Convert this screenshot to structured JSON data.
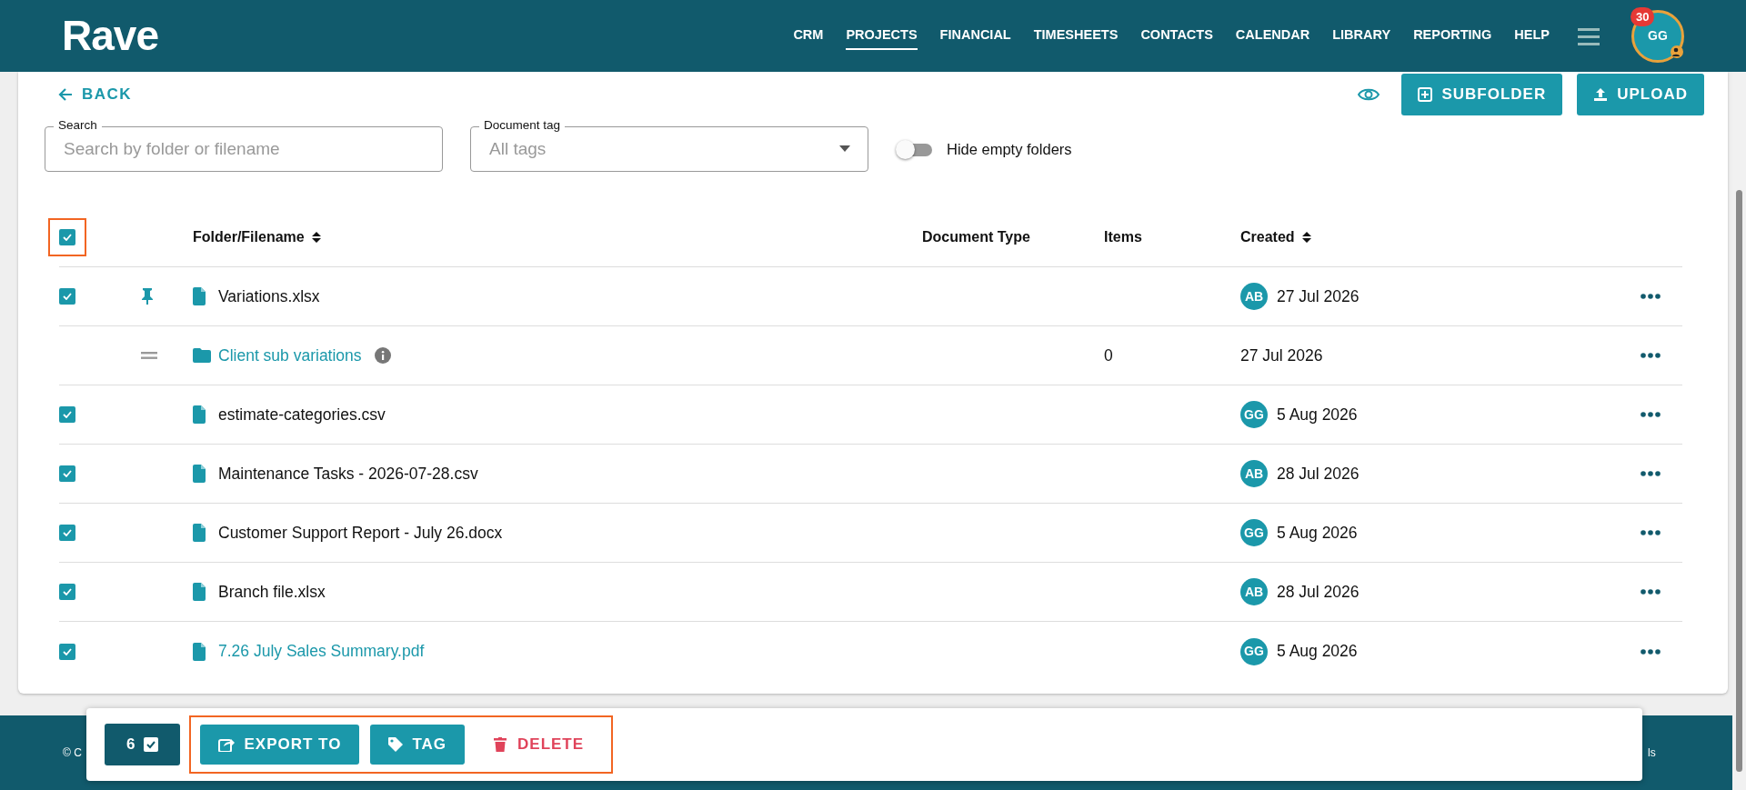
{
  "header": {
    "logo": "Rave",
    "nav": [
      {
        "label": "CRM",
        "selected": false
      },
      {
        "label": "PROJECTS",
        "selected": true
      },
      {
        "label": "FINANCIAL",
        "selected": false
      },
      {
        "label": "TIMESHEETS",
        "selected": false
      },
      {
        "label": "CONTACTS",
        "selected": false
      },
      {
        "label": "CALENDAR",
        "selected": false
      },
      {
        "label": "LIBRARY",
        "selected": false
      },
      {
        "label": "REPORTING",
        "selected": false
      },
      {
        "label": "HELP",
        "selected": false
      }
    ],
    "avatar": {
      "initials": "GG",
      "badge": "30"
    }
  },
  "toolbar": {
    "back": "BACK",
    "buttons": [
      "SUBFOLDER",
      "UPLOAD"
    ]
  },
  "filters": {
    "search": {
      "label": "Search",
      "placeholder": "Search by folder or filename"
    },
    "tag": {
      "label": "Document tag",
      "placeholder": "All tags"
    },
    "hide_empty": {
      "label": "Hide empty folders",
      "on": false
    }
  },
  "table": {
    "select_all": {
      "checked": true,
      "highlighted": true
    },
    "columns": [
      {
        "label": "Folder/Filename",
        "sortable": true
      },
      {
        "label": "Document Type",
        "sortable": false
      },
      {
        "label": "Items",
        "sortable": false
      },
      {
        "label": "Created",
        "sortable": true
      }
    ],
    "rows": [
      {
        "kind": "file",
        "checked": true,
        "pinned": true,
        "name": "Variations.xlsx",
        "link": false,
        "items": "",
        "creator": "AB",
        "created": "27 Jul 2026"
      },
      {
        "kind": "folder",
        "checked": false,
        "pinned": false,
        "name": "Client sub variations",
        "link": true,
        "info": true,
        "items": "0",
        "creator": "",
        "created": "27 Jul 2026"
      },
      {
        "kind": "file",
        "checked": true,
        "pinned": false,
        "name": "estimate-categories.csv",
        "link": false,
        "items": "",
        "creator": "GG",
        "created": "5 Aug 2026"
      },
      {
        "kind": "file",
        "checked": true,
        "pinned": false,
        "name": "Maintenance Tasks - 2026-07-28.csv",
        "link": false,
        "items": "",
        "creator": "AB",
        "created": "28 Jul 2026"
      },
      {
        "kind": "file",
        "checked": true,
        "pinned": false,
        "name": "Customer Support Report - July 26.docx",
        "link": false,
        "items": "",
        "creator": "GG",
        "created": "5 Aug 2026"
      },
      {
        "kind": "file",
        "checked": true,
        "pinned": false,
        "name": "Branch file.xlsx",
        "link": false,
        "items": "",
        "creator": "AB",
        "created": "28 Jul 2026"
      },
      {
        "kind": "file",
        "checked": true,
        "pinned": false,
        "name": "7.26 July Sales Summary.pdf",
        "link": true,
        "items": "",
        "creator": "GG",
        "created": "5 Aug 2026"
      }
    ]
  },
  "bulk_bar": {
    "count": "6",
    "highlighted": true,
    "actions": [
      {
        "label": "EXPORT TO",
        "kind": "export"
      },
      {
        "label": "TAG",
        "kind": "tag"
      },
      {
        "label": "DELETE",
        "kind": "delete"
      }
    ]
  },
  "footer": {
    "left": "© C",
    "right": "ls"
  }
}
